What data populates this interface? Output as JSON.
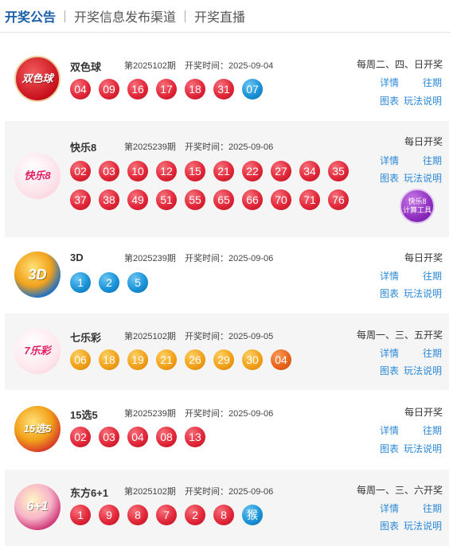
{
  "tabs": [
    {
      "label": "开奖公告"
    },
    {
      "label": "开奖信息发布渠道"
    },
    {
      "label": "开奖直播"
    }
  ],
  "common": {
    "details_label": "详情",
    "history_label": "往期",
    "chart_label": "图表",
    "rules_label": "玩法说明"
  },
  "lotteries": [
    {
      "name": "双色球",
      "period": "第2025102期",
      "date": "开奖时间：2025-09-04",
      "schedule": "每周二、四、日开奖",
      "logo_text": "双色球",
      "balls": [
        {
          "n": "04",
          "c": "red"
        },
        {
          "n": "09",
          "c": "red"
        },
        {
          "n": "16",
          "c": "red"
        },
        {
          "n": "17",
          "c": "red"
        },
        {
          "n": "18",
          "c": "red"
        },
        {
          "n": "31",
          "c": "red"
        },
        {
          "n": "07",
          "c": "blue"
        }
      ]
    },
    {
      "name": "快乐8",
      "period": "第2025239期",
      "date": "开奖时间：2025-09-06",
      "schedule": "每日开奖",
      "logo_text": "快乐8",
      "calc_label_1": "快乐8",
      "calc_label_2": "计算工具",
      "balls": [
        {
          "n": "02",
          "c": "red"
        },
        {
          "n": "03",
          "c": "red"
        },
        {
          "n": "10",
          "c": "red"
        },
        {
          "n": "12",
          "c": "red"
        },
        {
          "n": "15",
          "c": "red"
        },
        {
          "n": "21",
          "c": "red"
        },
        {
          "n": "22",
          "c": "red"
        },
        {
          "n": "27",
          "c": "red"
        },
        {
          "n": "34",
          "c": "red"
        },
        {
          "n": "35",
          "c": "red"
        },
        {
          "n": "37",
          "c": "red"
        },
        {
          "n": "38",
          "c": "red"
        },
        {
          "n": "49",
          "c": "red"
        },
        {
          "n": "51",
          "c": "red"
        },
        {
          "n": "55",
          "c": "red"
        },
        {
          "n": "65",
          "c": "red"
        },
        {
          "n": "66",
          "c": "red"
        },
        {
          "n": "70",
          "c": "red"
        },
        {
          "n": "71",
          "c": "red"
        },
        {
          "n": "76",
          "c": "red"
        }
      ]
    },
    {
      "name": "3D",
      "period": "第2025239期",
      "date": "开奖时间：2025-09-06",
      "schedule": "每日开奖",
      "logo_text": "3D",
      "balls": [
        {
          "n": "1",
          "c": "blue"
        },
        {
          "n": "2",
          "c": "blue"
        },
        {
          "n": "5",
          "c": "blue"
        }
      ]
    },
    {
      "name": "七乐彩",
      "period": "第2025102期",
      "date": "开奖时间：2025-09-05",
      "schedule": "每周一、三、五开奖",
      "logo_text": "7乐彩",
      "balls": [
        {
          "n": "06",
          "c": "orange"
        },
        {
          "n": "18",
          "c": "orange"
        },
        {
          "n": "19",
          "c": "orange"
        },
        {
          "n": "21",
          "c": "orange"
        },
        {
          "n": "26",
          "c": "orange"
        },
        {
          "n": "29",
          "c": "orange"
        },
        {
          "n": "30",
          "c": "orange"
        },
        {
          "n": "04",
          "c": "deeporange"
        }
      ]
    },
    {
      "name": "15选5",
      "period": "第2025239期",
      "date": "开奖时间：2025-09-06",
      "schedule": "每日开奖",
      "logo_text": "15选5",
      "balls": [
        {
          "n": "02",
          "c": "red"
        },
        {
          "n": "03",
          "c": "red"
        },
        {
          "n": "04",
          "c": "red"
        },
        {
          "n": "08",
          "c": "red"
        },
        {
          "n": "13",
          "c": "red"
        }
      ]
    },
    {
      "name": "东方6+1",
      "period": "第2025102期",
      "date": "开奖时间：2025-09-06",
      "schedule": "每周一、三、六开奖",
      "logo_text": "6+1",
      "balls": [
        {
          "n": "1",
          "c": "red"
        },
        {
          "n": "9",
          "c": "red"
        },
        {
          "n": "8",
          "c": "red"
        },
        {
          "n": "7",
          "c": "red"
        },
        {
          "n": "2",
          "c": "red"
        },
        {
          "n": "8",
          "c": "red"
        },
        {
          "n": "猴",
          "c": "blue"
        }
      ]
    }
  ],
  "colors": {
    "accent": "#1a5ea8",
    "link": "#2d88d6",
    "red_ball": "#e2283a",
    "blue_ball": "#1a93d8",
    "orange_ball": "#f2a21a"
  }
}
